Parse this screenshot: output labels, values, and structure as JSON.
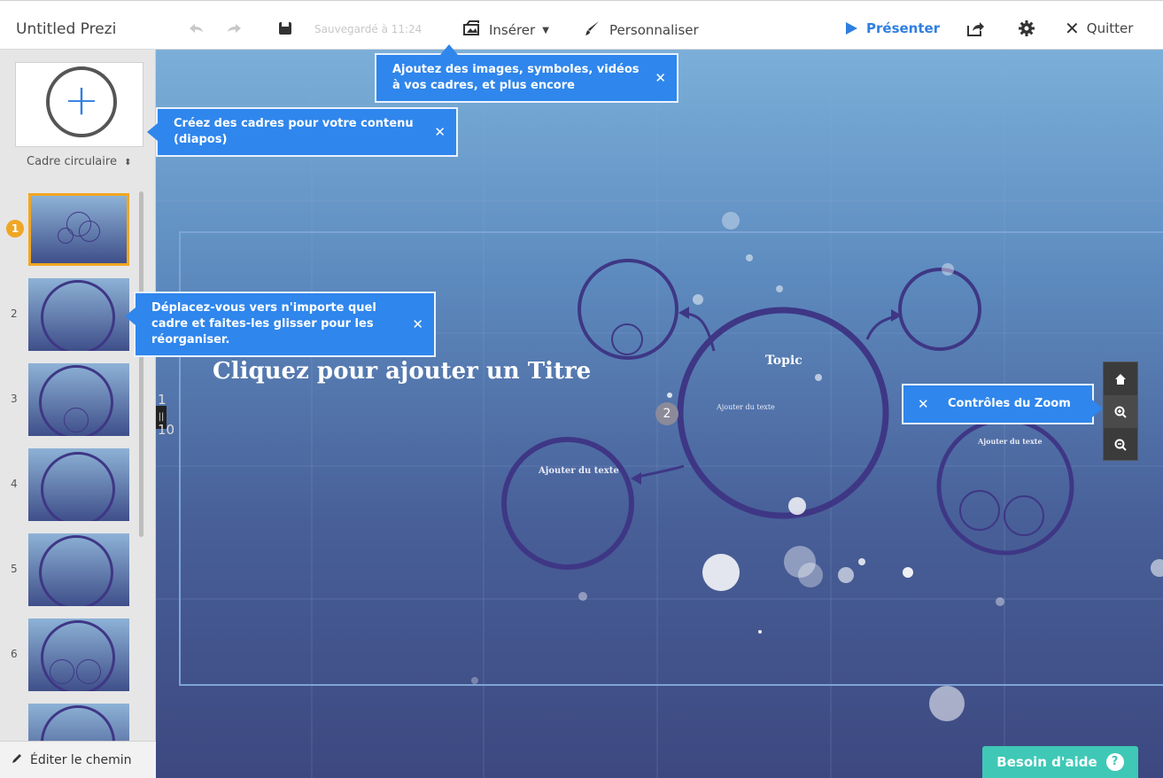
{
  "header": {
    "title": "Untitled Prezi",
    "saved_text": "Sauvegardé à 11:24",
    "insert_label": "Insérer",
    "customize_label": "Personnaliser",
    "present_label": "Présenter",
    "quit_label": "Quitter",
    "accent_color": "#2f7fe0"
  },
  "sidebar": {
    "frame_type": "Cadre circulaire",
    "thumbnails": [
      {
        "number": "1",
        "active": true
      },
      {
        "number": "2"
      },
      {
        "number": "3"
      },
      {
        "number": "4"
      },
      {
        "number": "5"
      },
      {
        "number": "6"
      }
    ],
    "edit_path_label": "Éditer le chemin"
  },
  "canvas": {
    "title_placeholder": "Cliquez pour ajouter un Titre",
    "topic_label": "Topic",
    "topic_sub": "Ajouter du texte",
    "left_circle_title": "Ajouter du texte",
    "right_circle_title": "Ajouter du texte",
    "path_number": "2",
    "side_num_top": "1",
    "side_num_bottom": "10"
  },
  "tooltips": {
    "insert_tip": "Ajoutez des images, symboles, vidéos à vos cadres, et plus encore",
    "frames_tip": "Créez des cadres pour votre contenu (diapos)",
    "move_tip": "Déplacez-vous vers n'importe quel cadre et faites-les glisser pour les réorganiser.",
    "zoom_tip": "Contrôles du Zoom"
  },
  "help": {
    "label": "Besoin d'aide",
    "color": "#3fc8b6"
  },
  "icons": [
    "undo-icon",
    "redo-icon",
    "save-icon",
    "insert-icon",
    "brush-icon",
    "play-icon",
    "share-icon",
    "gear-icon",
    "close-icon",
    "home-icon",
    "zoom-in-icon",
    "zoom-out-icon",
    "pencil-icon",
    "help-icon"
  ]
}
